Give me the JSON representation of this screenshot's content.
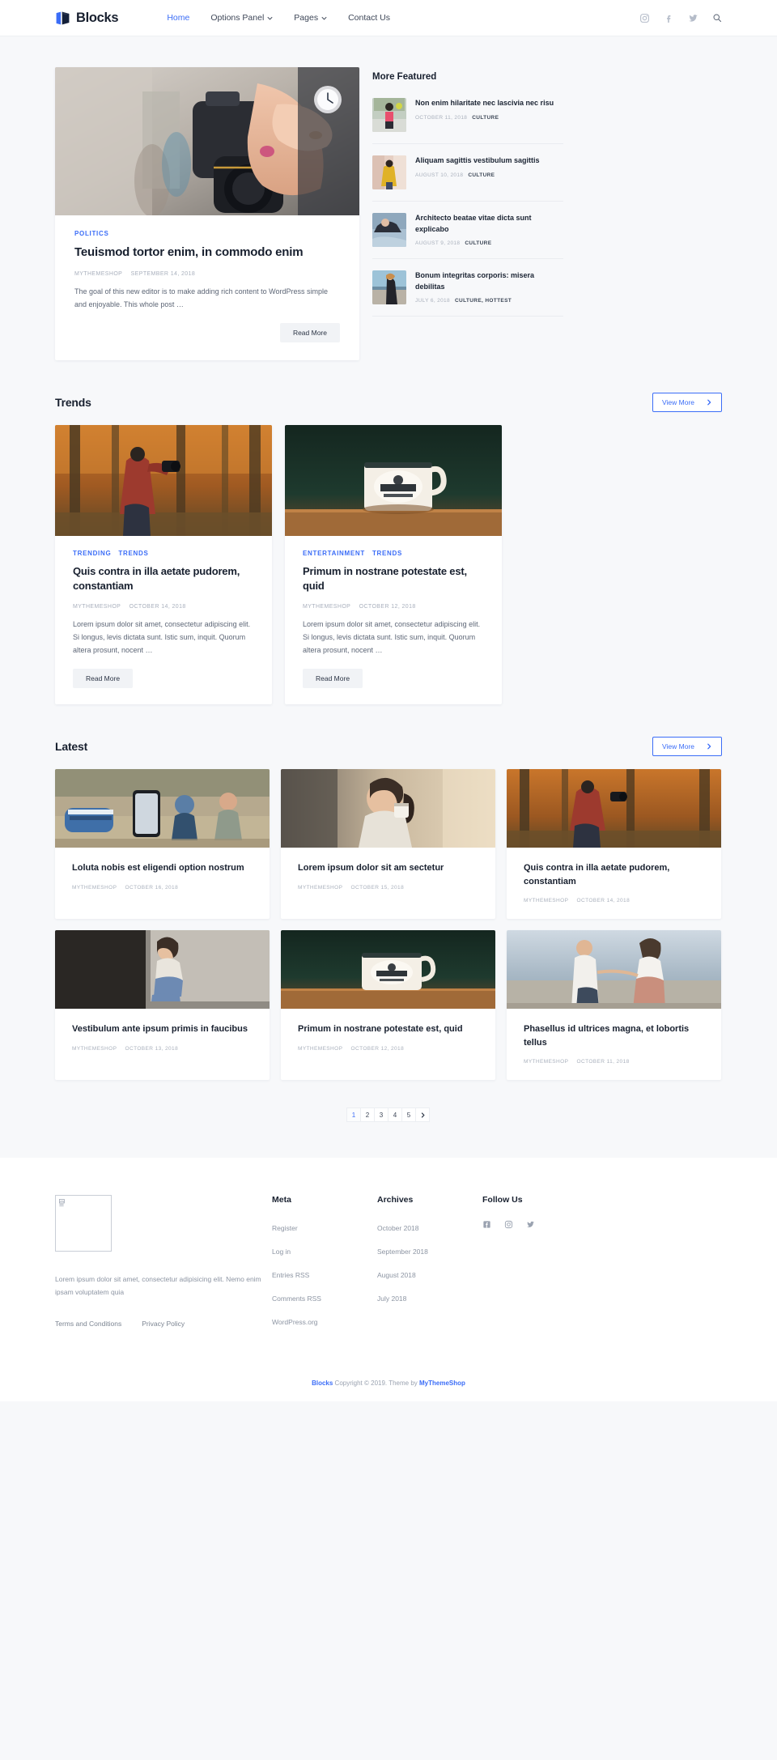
{
  "header": {
    "brand": "Blocks",
    "nav": [
      {
        "label": "Home",
        "active": true,
        "caret": false
      },
      {
        "label": "Options Panel",
        "active": false,
        "caret": true
      },
      {
        "label": "Pages",
        "active": false,
        "caret": true
      },
      {
        "label": "Contact Us",
        "active": false,
        "caret": false
      }
    ],
    "icons": [
      "instagram-icon",
      "facebook-icon",
      "twitter-icon",
      "search-icon"
    ]
  },
  "featured": {
    "category": "POLITICS",
    "title": "Teuismod tortor enim, in commodo enim",
    "author": "MYTHEMESHOP",
    "date": "SEPTEMBER 14, 2018",
    "excerpt": "The goal of this new editor is to make adding rich content to WordPress simple and enjoyable. This whole post …",
    "read_more": "Read More"
  },
  "sidebar": {
    "title": "More Featured",
    "items": [
      {
        "title": "Non enim hilaritate nec lascivia nec risu",
        "date": "OCTOBER 11, 2018",
        "categories": "CULTURE"
      },
      {
        "title": "Aliquam sagittis vestibulum sagittis",
        "date": "AUGUST 10, 2018",
        "categories": "CULTURE"
      },
      {
        "title": "Architecto beatae vitae dicta sunt explicabo",
        "date": "AUGUST 9, 2018",
        "categories": "CULTURE"
      },
      {
        "title": "Bonum integritas corporis: misera debilitas",
        "date": "JULY 6, 2018",
        "categories": "CULTURE, HOTTEST"
      }
    ]
  },
  "trends": {
    "section_title": "Trends",
    "view_more": "View More",
    "cards": [
      {
        "categories": [
          "TRENDING",
          "TRENDS"
        ],
        "title": "Quis contra in illa aetate pudorem, constantiam",
        "author": "MYTHEMESHOP",
        "date": "OCTOBER 14, 2018",
        "excerpt": "Lorem ipsum dolor sit amet, consectetur adipiscing elit. Si longus, levis dictata sunt. Istic sum, inquit. Quorum altera prosunt, nocent …",
        "read_more": "Read More"
      },
      {
        "categories": [
          "ENTERTAINMENT",
          "TRENDS"
        ],
        "title": "Primum in nostrane potestate est, quid",
        "author": "MYTHEMESHOP",
        "date": "OCTOBER 12, 2018",
        "excerpt": "Lorem ipsum dolor sit amet, consectetur adipiscing elit. Si longus, levis dictata sunt. Istic sum, inquit. Quorum altera prosunt, nocent …",
        "read_more": "Read More"
      }
    ]
  },
  "latest": {
    "section_title": "Latest",
    "view_more": "View More",
    "cards": [
      {
        "title": "Loluta nobis est eligendi option nostrum",
        "author": "MYTHEMESHOP",
        "date": "OCTOBER 16, 2018"
      },
      {
        "title": "Lorem ipsum dolor sit am sectetur",
        "author": "MYTHEMESHOP",
        "date": "OCTOBER 15, 2018"
      },
      {
        "title": "Quis contra in illa aetate pudorem, constantiam",
        "author": "MYTHEMESHOP",
        "date": "OCTOBER 14, 2018"
      },
      {
        "title": "Vestibulum ante ipsum primis in faucibus",
        "author": "MYTHEMESHOP",
        "date": "OCTOBER 13, 2018"
      },
      {
        "title": "Primum in nostrane potestate est, quid",
        "author": "MYTHEMESHOP",
        "date": "OCTOBER 12, 2018"
      },
      {
        "title": "Phasellus id ultrices magna, et lobortis tellus",
        "author": "MYTHEMESHOP",
        "date": "OCTOBER 11, 2018"
      }
    ]
  },
  "pagination": {
    "pages": [
      "1",
      "2",
      "3",
      "4",
      "5"
    ],
    "current": "1",
    "next_icon": "chevron-right-icon"
  },
  "footer": {
    "about_text": "Lorem ipsum dolor sit amet, consectetur adipisicing elit. Nemo enim ipsam voluptatem quia",
    "bottom_links": [
      {
        "label": "Terms and Conditions"
      },
      {
        "label": "Privacy Policy"
      }
    ],
    "meta": {
      "title": "Meta",
      "items": [
        "Register",
        "Log in",
        "Entries RSS",
        "Comments RSS",
        "WordPress.org"
      ]
    },
    "archives": {
      "title": "Archives",
      "items": [
        "October 2018",
        "September 2018",
        "August 2018",
        "July 2018"
      ]
    },
    "follow": {
      "title": "Follow Us",
      "icons": [
        "facebook-icon",
        "instagram-icon",
        "twitter-icon"
      ]
    },
    "copyright": {
      "brand": "Blocks",
      "text": " Copyright © 2019. Theme by ",
      "theme_author": "MyThemeShop"
    }
  },
  "colors": {
    "accent": "#3b6df7",
    "heading": "#18202f",
    "muted": "#a9b0bd",
    "page_bg": "#f7f8fa"
  }
}
